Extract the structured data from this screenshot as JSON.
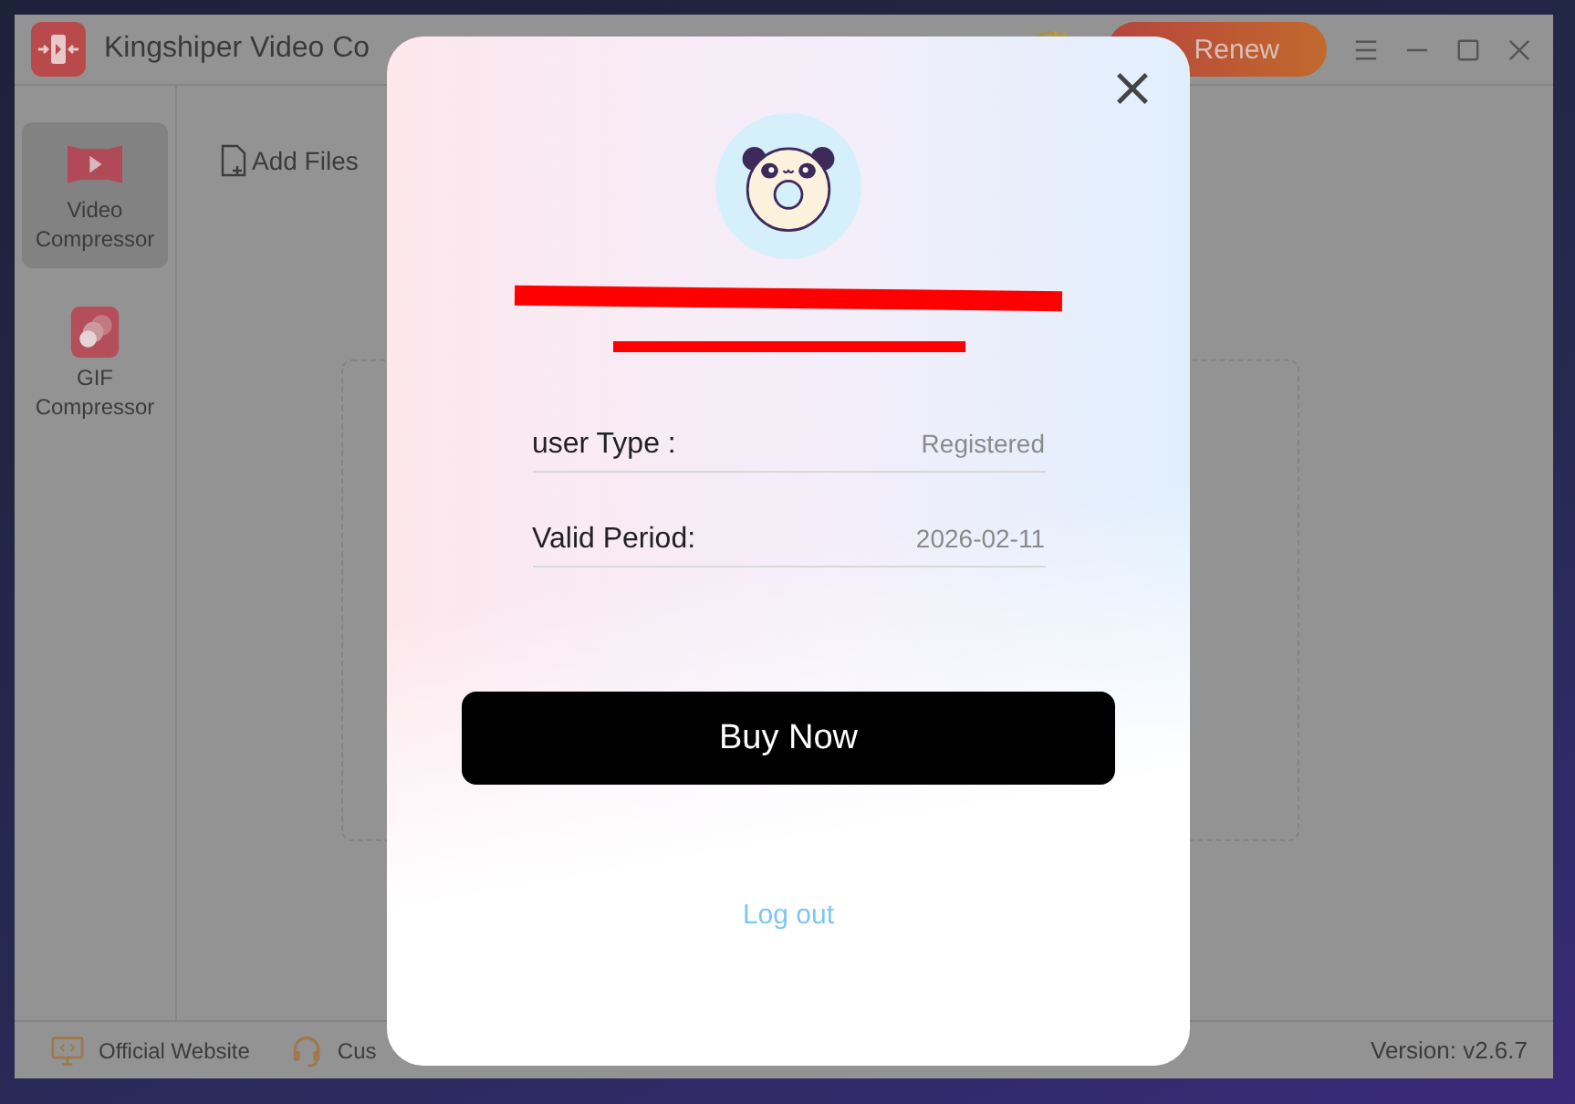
{
  "window": {
    "title": "Kingshiper Video Co",
    "renew_button": "Renew"
  },
  "sidebar": {
    "items": [
      {
        "label": "Video Compressor",
        "kind": "video",
        "selected": true
      },
      {
        "label": "GIF Compressor",
        "kind": "gif",
        "selected": false
      }
    ]
  },
  "toolbar": {
    "add_files": "Add Files"
  },
  "footer": {
    "links": [
      {
        "label": "Official Website",
        "kind": "website"
      },
      {
        "label": "Cus",
        "kind": "support"
      }
    ],
    "version": "Version: v2.6.7"
  },
  "account_dialog": {
    "fields": [
      {
        "label": "user Type :",
        "value": "Registered"
      },
      {
        "label": "Valid Period:",
        "value": "2026-02-11"
      }
    ],
    "buy_button": "Buy Now",
    "logout_link": "Log out"
  }
}
